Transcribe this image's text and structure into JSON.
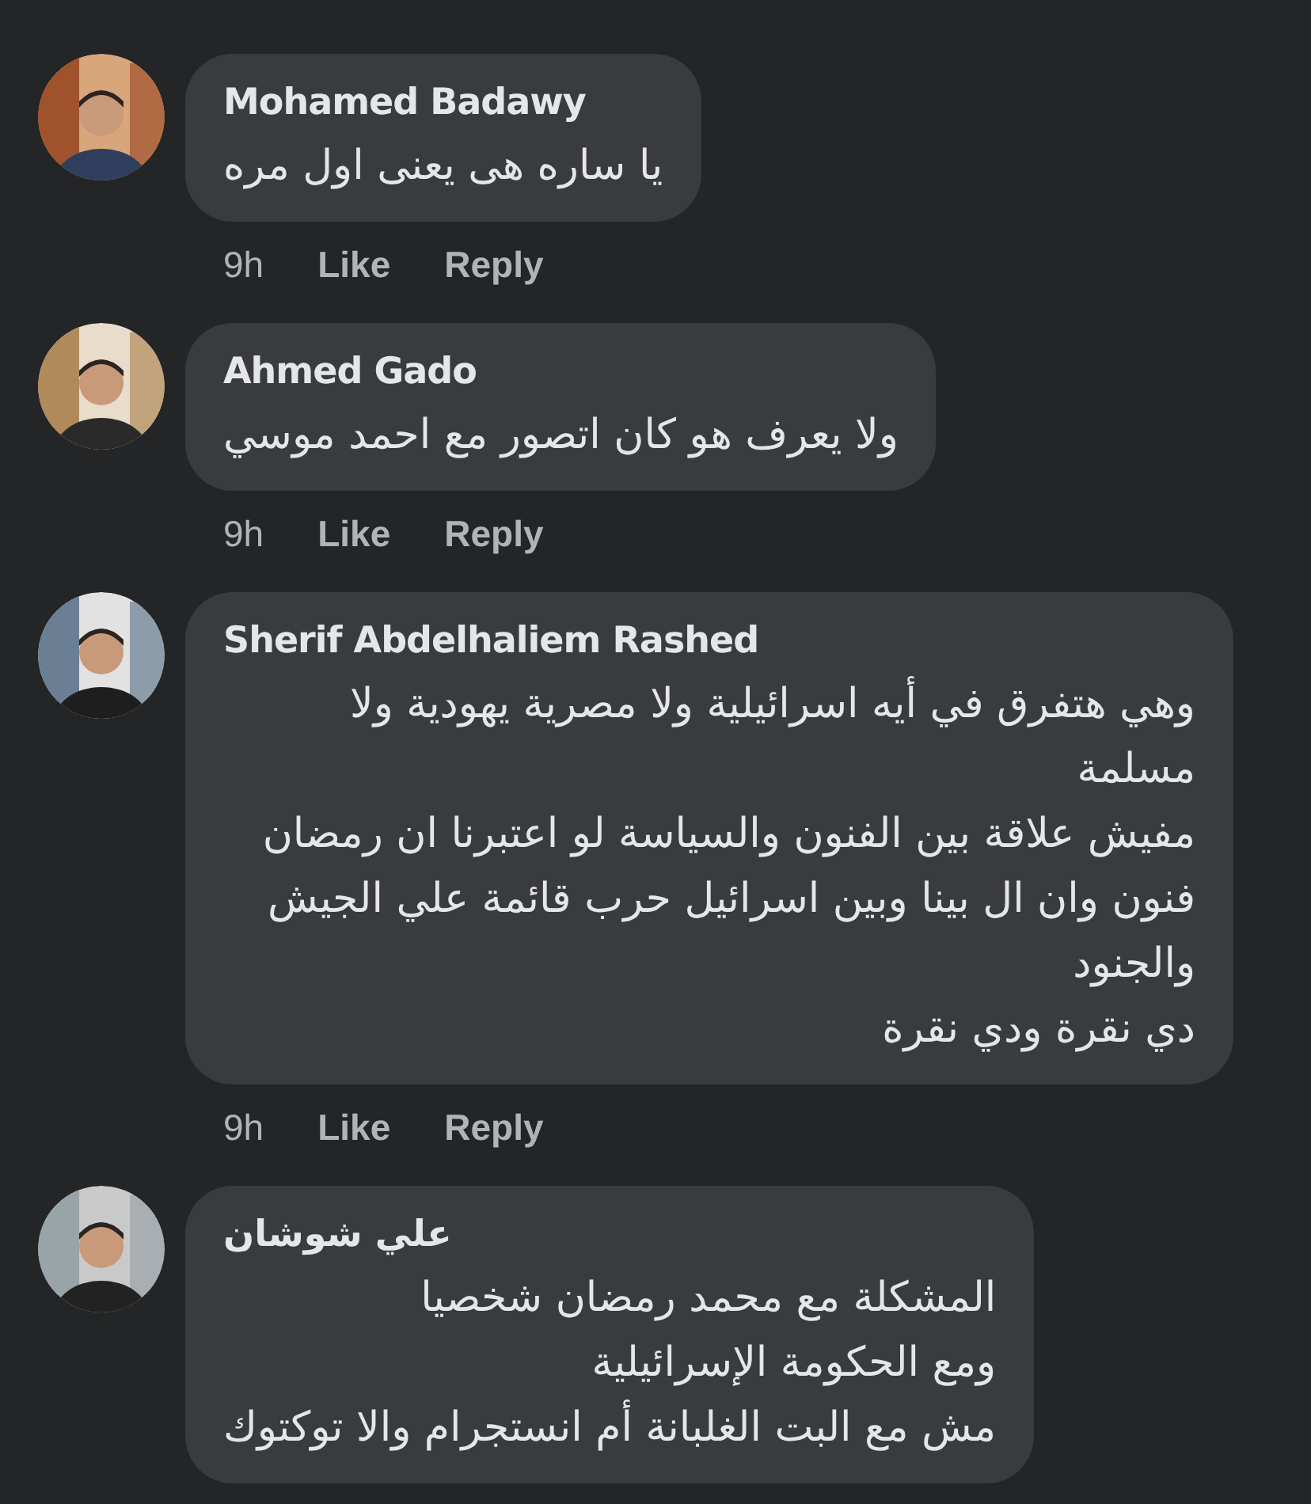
{
  "comments": [
    {
      "author": "Mohamed Badawy",
      "paragraphs": [
        "يا ساره هى يعنى اول مره"
      ],
      "meta": {
        "time": "9h",
        "like": "Like",
        "reply": "Reply"
      },
      "avatar": {
        "kind": "picture"
      }
    },
    {
      "author": "Ahmed Gado",
      "paragraphs": [
        "ولا يعرف هو كان اتصور مع احمد موسي"
      ],
      "meta": {
        "time": "9h",
        "like": "Like",
        "reply": "Reply"
      },
      "avatar": {
        "kind": "picture"
      }
    },
    {
      "author": "Sherif Abdelhaliem Rashed",
      "paragraphs": [
        "وهي هتفرق في أيه اسرائيلية ولا مصرية يهودية ولا مسلمة",
        "مفيش علاقة بين الفنون والسياسة لو اعتبرنا ان رمضان فنون وان ال بينا وبين اسرائيل حرب قائمة علي الجيش والجنود",
        "دي نقرة ودي نقرة"
      ],
      "meta": {
        "time": "9h",
        "like": "Like",
        "reply": "Reply"
      },
      "avatar": {
        "kind": "picture"
      }
    },
    {
      "author": "علي شوشان",
      "paragraphs": [
        "المشكلة مع محمد رمضان شخصيا",
        "ومع الحكومة الإسرائيلية",
        "مش مع البت الغلبانة أم انستجرام والا توكتوك"
      ],
      "avatar": {
        "kind": "picture"
      }
    }
  ]
}
